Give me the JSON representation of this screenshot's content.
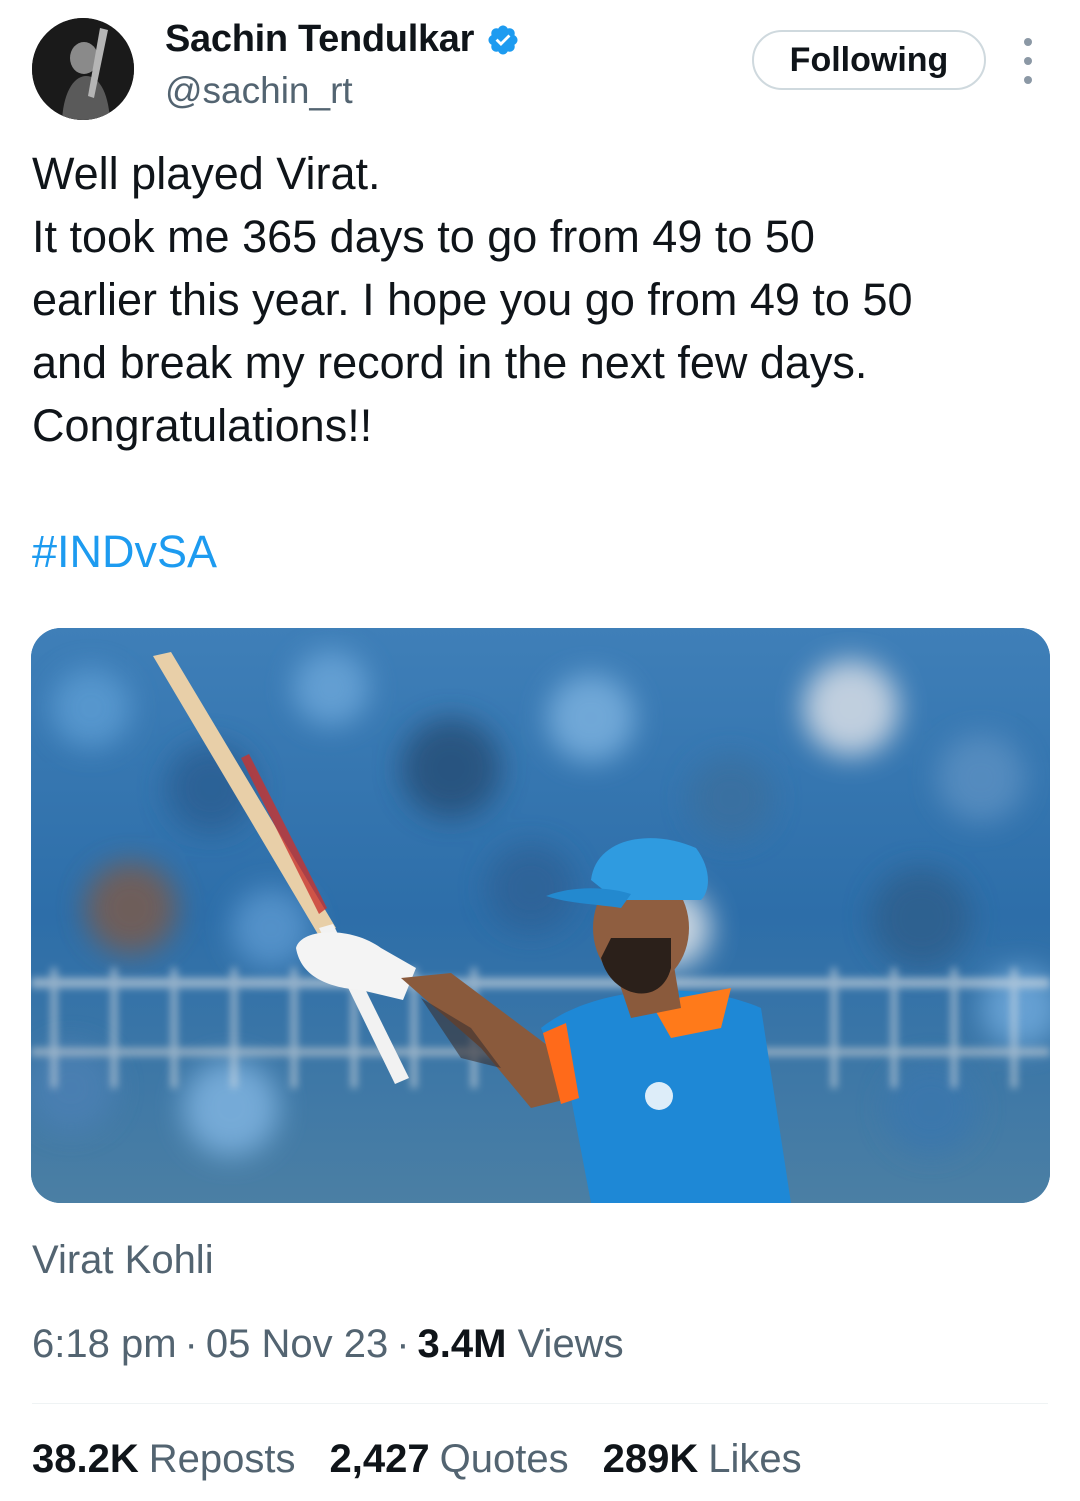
{
  "author": {
    "display_name": "Sachin Tendulkar",
    "handle": "@sachin_rt",
    "verified_icon": "verified-badge-icon",
    "verified_color": "#1d9bf0"
  },
  "follow_button": {
    "label": "Following"
  },
  "more_icon": "more-vertical-icon",
  "tweet": {
    "lines": [
      "Well played Virat.",
      "It took me 365 days to go from 49 to 50",
      "earlier this year. I hope you go from 49 to 50",
      "and break my record in the next few days.",
      "Congratulations!!"
    ],
    "hashtag": "#INDvSA",
    "hashtag_color": "#1d9bf0"
  },
  "media": {
    "tagged_person": "Virat Kohli"
  },
  "meta": {
    "time": "6:18 pm",
    "separator": "·",
    "date": "05 Nov 23",
    "views_count": "3.4M",
    "views_label": "Views"
  },
  "stats": {
    "reposts_count": "38.2K",
    "reposts_label": "Reposts",
    "quotes_count": "2,427",
    "quotes_label": "Quotes",
    "likes_count": "289K",
    "likes_label": "Likes"
  }
}
